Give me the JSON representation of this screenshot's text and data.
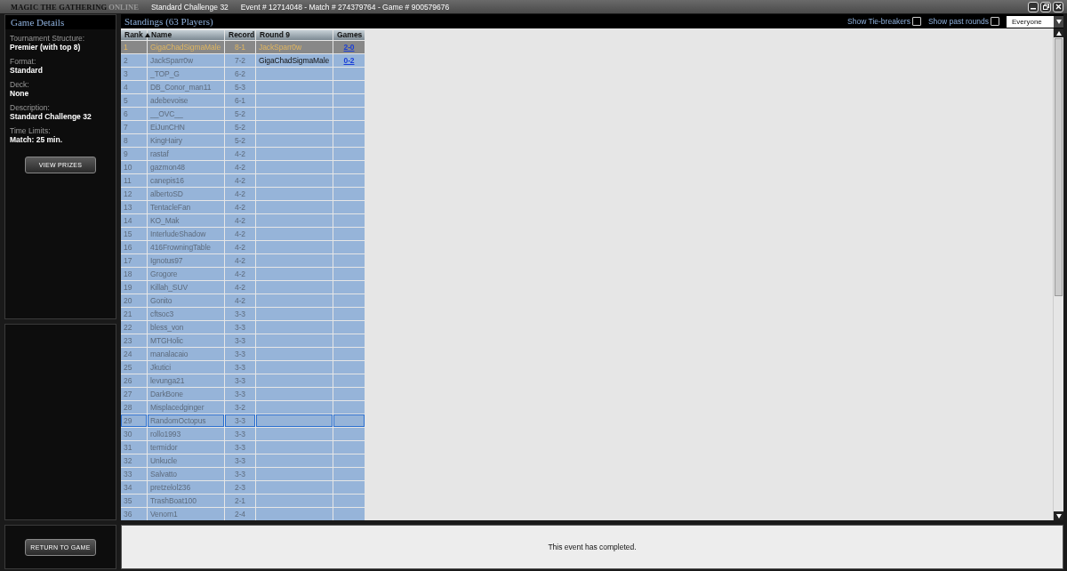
{
  "title_bar": {
    "logo": "MAGIC THE GATHERING",
    "logo_suffix": "ONLINE",
    "event_name": "Standard Challenge 32",
    "ids": "Event # 12714048 - Match # 274379764 - Game # 900579676"
  },
  "game_details": {
    "title": "Game Details",
    "fields": [
      {
        "label": "Tournament Structure:",
        "value": "Premier (with top 8)"
      },
      {
        "label": "Format:",
        "value": "Standard"
      },
      {
        "label": "Deck:",
        "value": "None"
      },
      {
        "label": "Description:",
        "value": "Standard Challenge 32"
      },
      {
        "label": "Time Limits:",
        "value": "Match: 25 min."
      }
    ],
    "button": "VIEW PRIZES"
  },
  "standings": {
    "title": "Standings (63 Players)",
    "options": [
      {
        "label": "Show Tie-breakers",
        "checked": false
      },
      {
        "label": "Show past rounds",
        "checked": false
      }
    ],
    "filter": "Everyone",
    "columns": [
      "Rank",
      "Name",
      "Record",
      "Round 9",
      "Games"
    ],
    "rows": [
      {
        "rank": "1",
        "name": "GigaChadSigmaMale",
        "record": "8-1",
        "opponent": "JackSparr0w",
        "games": "2-0",
        "selected": true,
        "focused": false
      },
      {
        "rank": "2",
        "name": "JackSparr0w",
        "record": "7-2",
        "opponent": "GigaChadSigmaMale",
        "games": "0-2",
        "selected": false,
        "focused": false
      },
      {
        "rank": "3",
        "name": "_TOP_G",
        "record": "6-2",
        "selected": false,
        "focused": false
      },
      {
        "rank": "4",
        "name": "DB_Conor_man11",
        "record": "5-3",
        "selected": false,
        "focused": false
      },
      {
        "rank": "5",
        "name": "adebevoise",
        "record": "6-1",
        "selected": false,
        "focused": false
      },
      {
        "rank": "6",
        "name": "__OVC__",
        "record": "5-2",
        "selected": false,
        "focused": false
      },
      {
        "rank": "7",
        "name": "EiJunCHN",
        "record": "5-2",
        "selected": false,
        "focused": false
      },
      {
        "rank": "8",
        "name": "KingHairy",
        "record": "5-2",
        "selected": false,
        "focused": false
      },
      {
        "rank": "9",
        "name": "rastaf",
        "record": "4-2",
        "selected": false,
        "focused": false
      },
      {
        "rank": "10",
        "name": "gazmon48",
        "record": "4-2",
        "selected": false,
        "focused": false
      },
      {
        "rank": "11",
        "name": "canepis16",
        "record": "4-2",
        "selected": false,
        "focused": false
      },
      {
        "rank": "12",
        "name": "albertoSD",
        "record": "4-2",
        "selected": false,
        "focused": false
      },
      {
        "rank": "13",
        "name": "TentacleFan",
        "record": "4-2",
        "selected": false,
        "focused": false
      },
      {
        "rank": "14",
        "name": "KO_Mak",
        "record": "4-2",
        "selected": false,
        "focused": false
      },
      {
        "rank": "15",
        "name": "InterludeShadow",
        "record": "4-2",
        "selected": false,
        "focused": false
      },
      {
        "rank": "16",
        "name": "416FrowningTable",
        "record": "4-2",
        "selected": false,
        "focused": false
      },
      {
        "rank": "17",
        "name": "Ignotus97",
        "record": "4-2",
        "selected": false,
        "focused": false
      },
      {
        "rank": "18",
        "name": "Grogore",
        "record": "4-2",
        "selected": false,
        "focused": false
      },
      {
        "rank": "19",
        "name": "Killah_SUV",
        "record": "4-2",
        "selected": false,
        "focused": false
      },
      {
        "rank": "20",
        "name": "Gonito",
        "record": "4-2",
        "selected": false,
        "focused": false
      },
      {
        "rank": "21",
        "name": "cftsoc3",
        "record": "3-3",
        "selected": false,
        "focused": false
      },
      {
        "rank": "22",
        "name": "bless_von",
        "record": "3-3",
        "selected": false,
        "focused": false
      },
      {
        "rank": "23",
        "name": "MTGHolic",
        "record": "3-3",
        "selected": false,
        "focused": false
      },
      {
        "rank": "24",
        "name": "manalacaio",
        "record": "3-3",
        "selected": false,
        "focused": false
      },
      {
        "rank": "25",
        "name": "Jkutici",
        "record": "3-3",
        "selected": false,
        "focused": false
      },
      {
        "rank": "26",
        "name": "levunga21",
        "record": "3-3",
        "selected": false,
        "focused": false
      },
      {
        "rank": "27",
        "name": "DarkBone",
        "record": "3-3",
        "selected": false,
        "focused": false
      },
      {
        "rank": "28",
        "name": "Misplacedginger",
        "record": "3-2",
        "selected": false,
        "focused": false
      },
      {
        "rank": "29",
        "name": "RandomOctopus",
        "record": "3-3",
        "selected": false,
        "focused": true
      },
      {
        "rank": "30",
        "name": "rollo1993",
        "record": "3-3",
        "selected": false,
        "focused": false
      },
      {
        "rank": "31",
        "name": "termidor",
        "record": "3-3",
        "selected": false,
        "focused": false
      },
      {
        "rank": "32",
        "name": "Unkucle",
        "record": "3-3",
        "selected": false,
        "focused": false
      },
      {
        "rank": "33",
        "name": "Salvatto",
        "record": "3-3",
        "selected": false,
        "focused": false
      },
      {
        "rank": "34",
        "name": "pretzelol236",
        "record": "2-3",
        "selected": false,
        "focused": false
      },
      {
        "rank": "35",
        "name": "TrashBoat100",
        "record": "2-1",
        "selected": false,
        "focused": false
      },
      {
        "rank": "36",
        "name": "Venom1",
        "record": "2-4",
        "selected": false,
        "focused": false
      }
    ]
  },
  "footer": {
    "button": "RETURN TO GAME",
    "message": "This event has completed."
  }
}
